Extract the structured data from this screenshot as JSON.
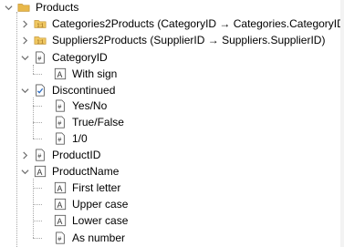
{
  "tree": {
    "root": {
      "label": "Products",
      "icon": "folder-icon"
    },
    "nodes": [
      {
        "label": "Categories2Products (CategoryID → Categories.CategoryID)",
        "icon": "relation-icon",
        "expanded": false
      },
      {
        "label": "Suppliers2Products (SupplierID → Suppliers.SupplierID)",
        "icon": "relation-icon",
        "expanded": false
      },
      {
        "label": "CategoryID",
        "icon": "numeric-field-icon",
        "expanded": true,
        "children": [
          {
            "label": "With sign",
            "icon": "text-field-icon"
          }
        ]
      },
      {
        "label": "Discontinued",
        "icon": "boolean-field-icon",
        "expanded": true,
        "children": [
          {
            "label": "Yes/No",
            "icon": "numeric-field-icon"
          },
          {
            "label": "True/False",
            "icon": "numeric-field-icon"
          },
          {
            "label": "1/0",
            "icon": "numeric-field-icon"
          }
        ]
      },
      {
        "label": "ProductID",
        "icon": "numeric-field-icon",
        "expanded": false
      },
      {
        "label": "ProductName",
        "icon": "text-field-icon",
        "expanded": true,
        "children": [
          {
            "label": "First letter",
            "icon": "text-field-icon"
          },
          {
            "label": "Upper case",
            "icon": "text-field-icon"
          },
          {
            "label": "Lower case",
            "icon": "text-field-icon"
          },
          {
            "label": "As number",
            "icon": "numeric-field-icon"
          }
        ]
      }
    ]
  },
  "colors": {
    "folder": "#e8b84a",
    "relation": "#d9a441",
    "icon_border": "#5a5a5a",
    "chevron": "#6b6b6b",
    "guide": "#a8a8a8"
  }
}
